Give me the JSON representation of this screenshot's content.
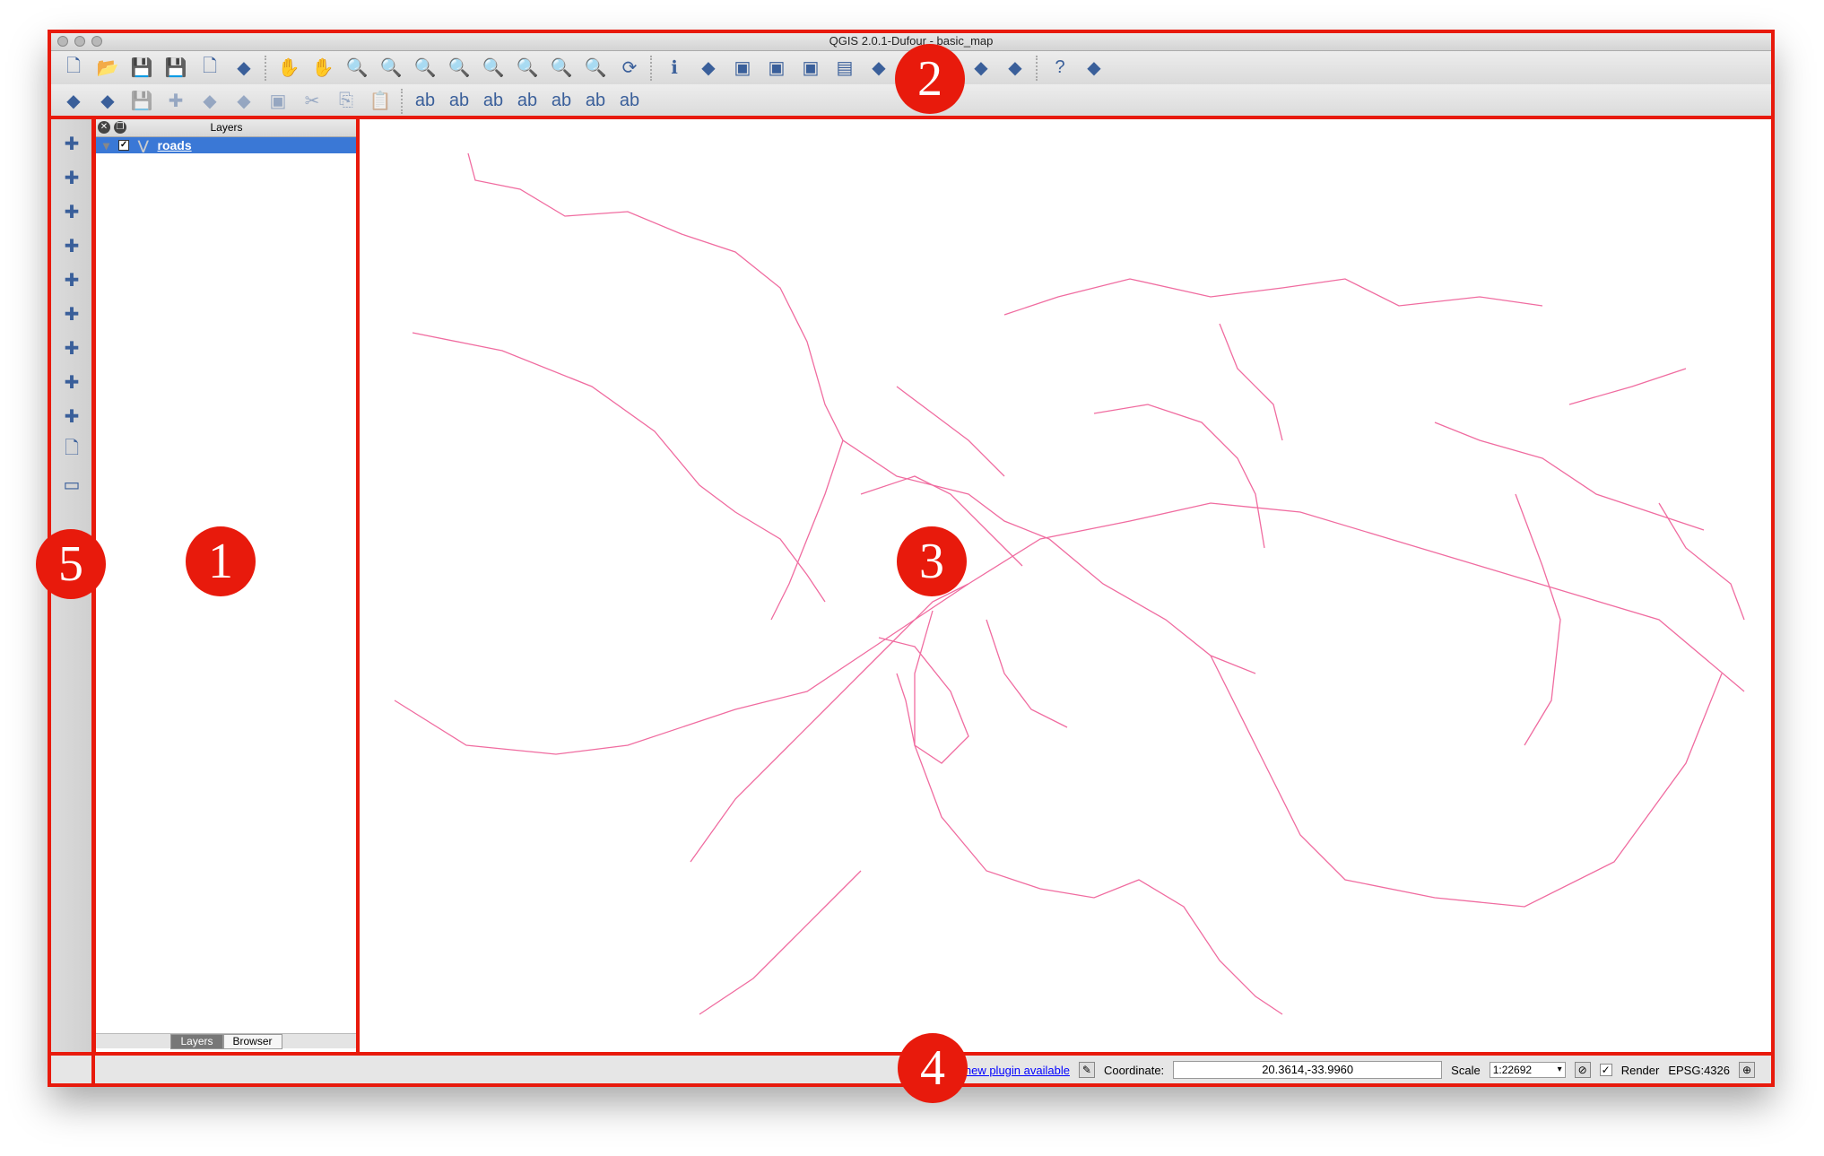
{
  "window": {
    "title": "QGIS 2.0.1-Dufour - basic_map"
  },
  "toolbar1": [
    "new-project-icon",
    "open-project-icon",
    "save-project-icon",
    "save-as-icon",
    "new-print-composer-icon",
    "composer-manager-icon",
    "|",
    "pan-icon",
    "pan-to-selection-icon",
    "zoom-in-icon",
    "zoom-out-icon",
    "zoom-native-icon",
    "zoom-full-icon",
    "zoom-to-selection-icon",
    "zoom-to-layer-icon",
    "zoom-last-icon",
    "zoom-next-icon",
    "refresh-icon",
    "|",
    "identify-icon",
    "measure-icon",
    "select-features-icon",
    "deselect-icon",
    "expression-select-icon",
    "attribute-table-icon",
    "statistics-icon",
    "map-tips-icon",
    "new-bookmark-icon",
    "show-bookmarks-icon",
    "text-annotation-icon",
    "|",
    "help-icon",
    "whats-this-icon"
  ],
  "toolbar2": [
    "toggle-editing-icon",
    "current-edits-icon",
    "save-edits-icon",
    "add-feature-icon",
    "move-feature-icon",
    "node-tool-icon",
    "delete-selected-icon",
    "cut-features-icon",
    "copy-features-icon",
    "paste-features-icon",
    "|",
    "label-icon",
    "pin-label-icon",
    "move-label-icon",
    "show-hide-labels-icon",
    "rotate-label-icon",
    "change-label-icon",
    "label-properties-icon"
  ],
  "lefttoolbar": [
    "add-vector-layer-icon",
    "add-raster-layer-icon",
    "add-postgis-layer-icon",
    "add-spatialite-layer-icon",
    "add-mssql-layer-icon",
    "add-wms-layer-icon",
    "add-wcs-layer-icon",
    "add-wfs-layer-icon",
    "add-delimited-text-icon",
    "new-shapefile-icon",
    "remove-layer-icon"
  ],
  "layers_panel": {
    "title": "Layers",
    "layers": [
      {
        "name": "roads",
        "visible": true
      }
    ],
    "tabs": [
      "Layers",
      "Browser"
    ],
    "active_tab": "Layers"
  },
  "status": {
    "plugin_msg": "new plugin available",
    "coord_label": "Coordinate:",
    "coord_value": "20.3614,-33.9960",
    "scale_label": "Scale",
    "scale_value": "1:22692",
    "render_label": "Render",
    "render_checked": true,
    "crs": "EPSG:4326"
  },
  "annotations": [
    "1",
    "2",
    "3",
    "4",
    "5"
  ],
  "colors": {
    "accent": "#e81a0c",
    "roads": "#f06ca0",
    "selection": "#3a78d6"
  }
}
